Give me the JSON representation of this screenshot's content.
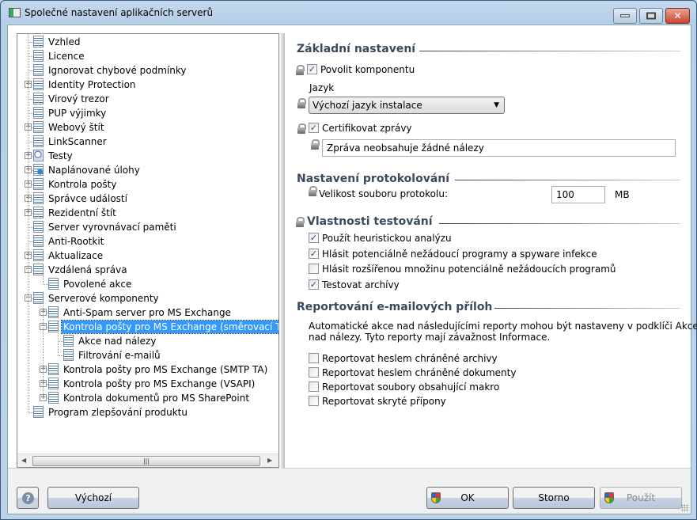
{
  "window": {
    "title": "Společné nastavení aplikačních serverů"
  },
  "tree": {
    "items": [
      {
        "label": "Vzhled",
        "level": 0,
        "expander": "none",
        "icon": "page"
      },
      {
        "label": "Licence",
        "level": 0,
        "expander": "none",
        "icon": "page"
      },
      {
        "label": "Ignorovat chybové podmínky",
        "level": 0,
        "expander": "none",
        "icon": "page"
      },
      {
        "label": "Identity Protection",
        "level": 0,
        "expander": "plus",
        "icon": "page"
      },
      {
        "label": "Virový trezor",
        "level": 0,
        "expander": "none",
        "icon": "page"
      },
      {
        "label": "PUP výjimky",
        "level": 0,
        "expander": "none",
        "icon": "page"
      },
      {
        "label": "Webový štít",
        "level": 0,
        "expander": "plus",
        "icon": "page"
      },
      {
        "label": "LinkScanner",
        "level": 0,
        "expander": "none",
        "icon": "page"
      },
      {
        "label": "Testy",
        "level": 0,
        "expander": "plus",
        "icon": "search"
      },
      {
        "label": "Naplánované úlohy",
        "level": 0,
        "expander": "plus",
        "icon": "sched"
      },
      {
        "label": "Kontrola pošty",
        "level": 0,
        "expander": "plus",
        "icon": "page"
      },
      {
        "label": "Správce událostí",
        "level": 0,
        "expander": "plus",
        "icon": "page"
      },
      {
        "label": "Rezidentní štít",
        "level": 0,
        "expander": "plus",
        "icon": "page"
      },
      {
        "label": "Server vyrovnávací paměti",
        "level": 0,
        "expander": "none",
        "icon": "page"
      },
      {
        "label": "Anti-Rootkit",
        "level": 0,
        "expander": "none",
        "icon": "page"
      },
      {
        "label": "Aktualizace",
        "level": 0,
        "expander": "plus",
        "icon": "page"
      },
      {
        "label": "Vzdálená správa",
        "level": 0,
        "expander": "minus",
        "icon": "page"
      },
      {
        "label": "Povolené akce",
        "level": 1,
        "expander": "none",
        "icon": "page"
      },
      {
        "label": "Serverové komponenty",
        "level": 0,
        "expander": "minus",
        "icon": "page"
      },
      {
        "label": "Anti-Spam server pro MS Exchange",
        "level": 1,
        "expander": "plus",
        "icon": "page"
      },
      {
        "label": "Kontrola pošty pro MS Exchange (směrovací TA)",
        "level": 1,
        "expander": "minus",
        "icon": "page",
        "selected": true
      },
      {
        "label": "Akce nad nálezy",
        "level": 2,
        "expander": "none",
        "icon": "page"
      },
      {
        "label": "Filtrování e-mailů",
        "level": 2,
        "expander": "none",
        "icon": "page"
      },
      {
        "label": "Kontrola pošty pro MS Exchange (SMTP TA)",
        "level": 1,
        "expander": "plus",
        "icon": "page"
      },
      {
        "label": "Kontrola pošty pro MS Exchange (VSAPI)",
        "level": 1,
        "expander": "plus",
        "icon": "page"
      },
      {
        "label": "Kontrola dokumentů pro MS SharePoint",
        "level": 1,
        "expander": "plus",
        "icon": "page"
      },
      {
        "label": "Program zlepšování produktu",
        "level": 0,
        "expander": "none",
        "icon": "page"
      }
    ],
    "selected_color": "#3399ff"
  },
  "basic": {
    "heading": "Základní nastavení",
    "enable_component": {
      "label": "Povolit komponentu",
      "checked": true
    },
    "language_label": "Jazyk",
    "language_value": "Výchozí jazyk instalace",
    "certify": {
      "label": "Certifikovat zprávy",
      "checked": true
    },
    "certify_text": "Zpráva neobsahuje žádné nálezy"
  },
  "logging": {
    "heading": "Nastavení protokolování",
    "size_label": "Velikost souboru protokolu:",
    "size_value": "100",
    "size_unit": "MB"
  },
  "scan": {
    "heading": "Vlastnosti testování",
    "options": [
      {
        "label": "Použít heuristickou analýzu",
        "checked": true
      },
      {
        "label": "Hlásit potenciálně nežádoucí programy a spyware infekce",
        "checked": true
      },
      {
        "label": "Hlásit rozšířenou množinu potenciálně nežádoucích programů",
        "checked": false
      },
      {
        "label": "Testovat archívy",
        "checked": true
      }
    ]
  },
  "attach": {
    "heading": "Reportování e-mailových příloh",
    "description_line1": "Automatické akce nad následujícími reporty mohou být nastaveny v podklíči Akce",
    "description_line2": "nad nálezy. Tyto reporty mají závažnost Informace.",
    "options": [
      {
        "label": "Reportovat heslem chráněné archivy",
        "checked": false
      },
      {
        "label": "Reportovat heslem chráněné dokumenty",
        "checked": false
      },
      {
        "label": "Reportovat soubory obsahující makro",
        "checked": false
      },
      {
        "label": "Reportovat skryté přípony",
        "checked": false
      }
    ]
  },
  "buttons": {
    "help": "?",
    "default": "Výchozí",
    "ok": "OK",
    "cancel": "Storno",
    "apply": "Použít"
  }
}
